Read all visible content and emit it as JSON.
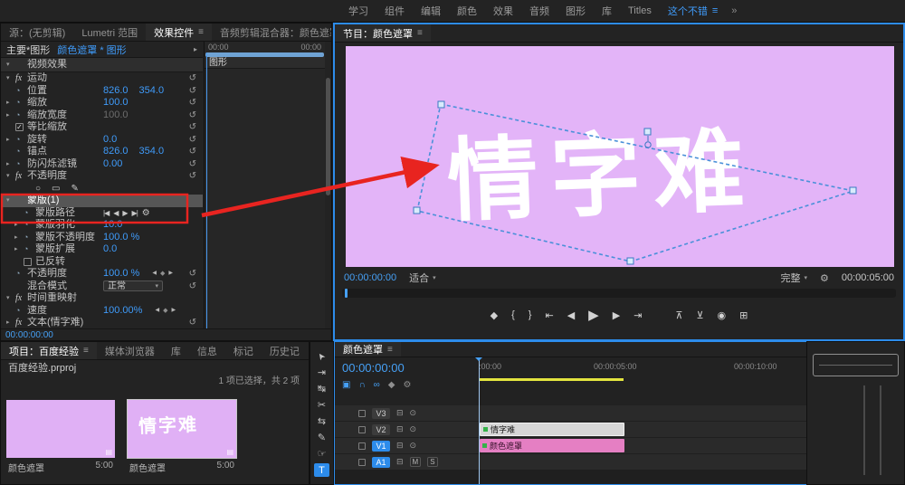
{
  "colors": {
    "accent_blue": "#2d8ceb",
    "value_blue": "#3f9bfa",
    "timecode_blue": "#46a0f5",
    "matte_purple": "#e3b4f8",
    "matte_pink_clip": "#e57fc3",
    "selected_clip_gray": "#d6d6d6",
    "render_bar_yellow": "#e2e43f",
    "annotation_red": "#e82420",
    "mask_outline_blue": "#4a90d9",
    "fx_badge_green": "#36b24a"
  },
  "icons": {
    "menu": "≡",
    "overflow": "»",
    "dropdown": "▾",
    "chevron_open": "▾",
    "chevron_closed": "▸",
    "stopwatch": "◔",
    "reset": "↺",
    "check": "✓",
    "ellipse": "○",
    "rectangle": "▭",
    "pen": "✎",
    "kf_prev": "◀",
    "kf_add": "◆",
    "kf_next": "▶",
    "mask_prev_frame": "|◀",
    "mask_track_back": "◀",
    "mask_track_fwd": "▶",
    "mask_next_frame": "▶|",
    "wrench": "⚙",
    "eye": "⊙",
    "insert": "⊟",
    "marker": "◆",
    "mark_in": "{",
    "mark_out": "}",
    "goto_in": "⇤",
    "step_back": "◀",
    "play": "▶",
    "step_fwd": "▶",
    "goto_out": "⇥",
    "lift": "⊼",
    "extract": "⊻",
    "export_frame": "◉",
    "compare": "⊞",
    "nest": "▣",
    "snap": "∩",
    "link": "∞",
    "settings": "⚙",
    "badge": "▤",
    "tool_selection": "➤",
    "tool_track": "⇥",
    "tool_ripple": "↹",
    "tool_razor": "✂",
    "tool_slip": "⇆",
    "tool_pen": "✎",
    "tool_hand": "☞",
    "tool_type": "T"
  },
  "top_bar": {
    "workspaces": [
      "学习",
      "组件",
      "编辑",
      "颜色",
      "效果",
      "音频",
      "图形",
      "库",
      "Titles",
      "这个不错"
    ],
    "active_workspace": "这个不错"
  },
  "effect_controls": {
    "tabs": [
      {
        "label": "源：(无剪辑)",
        "active": false
      },
      {
        "label": "Lumetri 范围",
        "active": false
      },
      {
        "label": "效果控件",
        "active": true,
        "menu": true
      },
      {
        "label": "音频剪辑混合器：颜色遮罩",
        "active": false
      }
    ],
    "master_label": "主要*图形",
    "clip_label": "颜色遮罩 * 图形",
    "rows": [
      {
        "section": true,
        "chevron": "open",
        "label": "视频效果"
      },
      {
        "chevron": "open",
        "fx": true,
        "label": "运动",
        "reset": true
      },
      {
        "stopwatch": true,
        "label": "位置",
        "values": [
          "826.0",
          "354.0"
        ],
        "reset": true
      },
      {
        "chevron": "closed",
        "stopwatch": true,
        "label": "缩放",
        "values": [
          "100.0"
        ],
        "reset": true
      },
      {
        "chevron": "closed",
        "stopwatch": true,
        "label": "缩放宽度",
        "values": [
          "100.0"
        ],
        "grayed": true,
        "reset": true
      },
      {
        "checkbox": true,
        "label": "等比缩放",
        "reset": true
      },
      {
        "chevron": "closed",
        "stopwatch": true,
        "label": "旋转",
        "values": [
          "0.0"
        ],
        "reset": true
      },
      {
        "stopwatch": true,
        "label": "锚点",
        "values": [
          "826.0",
          "354.0"
        ],
        "reset": true
      },
      {
        "chevron": "closed",
        "stopwatch": true,
        "label": "防闪烁滤镜",
        "values": [
          "0.00"
        ],
        "reset": true
      },
      {
        "chevron": "open",
        "fx": true,
        "label": "不透明度",
        "reset": true
      },
      {
        "tools": true
      },
      {
        "chevron": "open",
        "label": "蒙版(1)",
        "highlighted": true
      },
      {
        "stopwatch": true,
        "label": "蒙版路径",
        "masknav": true,
        "indent": 1
      },
      {
        "chevron": "closed",
        "stopwatch": true,
        "label": "蒙版羽化",
        "values": [
          "10.0"
        ],
        "indent": 1
      },
      {
        "chevron": "closed",
        "stopwatch": true,
        "label": "蒙版不透明度",
        "values": [
          "100.0"
        ],
        "unit": "%",
        "indent": 1
      },
      {
        "chevron": "closed",
        "stopwatch": true,
        "label": "蒙版扩展",
        "values": [
          "0.0"
        ],
        "indent": 1
      },
      {
        "checkbox": false,
        "label": "已反转",
        "indent": 1
      },
      {
        "stopwatch": true,
        "label": "不透明度",
        "values": [
          "100.0"
        ],
        "unit": "%",
        "kfnav": true,
        "reset": true
      },
      {
        "label": "混合模式",
        "dropdown": "正常",
        "reset": true
      },
      {
        "chevron": "open",
        "fx": true,
        "label": "时间重映射"
      },
      {
        "stopwatch": true,
        "label": "速度",
        "values": [
          "100.00%"
        ],
        "kfnav": true
      },
      {
        "chevron": "closed",
        "fx": true,
        "label": "文本(情字难)",
        "reset": true
      }
    ],
    "mini_timeline": {
      "ruler_start": "00:00",
      "ruler_end": "00:00",
      "clip_name": "图形"
    },
    "footer_timecode": "00:00:00:00"
  },
  "program_monitor": {
    "tab": "节目：颜色遮罩",
    "overlay_text": "情字难",
    "timecode": "00:00:00:00",
    "zoom_select": "适合",
    "playback_res": "完整",
    "duration": "00:00:05:00",
    "transport": [
      {
        "name": "add-marker-button",
        "icon": "marker"
      },
      {
        "name": "mark-in-button",
        "icon": "mark_in"
      },
      {
        "name": "mark-out-button",
        "icon": "mark_out"
      },
      {
        "name": "go-to-in-button",
        "icon": "goto_in"
      },
      {
        "name": "step-back-button",
        "icon": "step_back"
      },
      {
        "name": "play-button",
        "icon": "play",
        "big": true
      },
      {
        "name": "step-forward-button",
        "icon": "step_fwd"
      },
      {
        "name": "go-to-out-button",
        "icon": "goto_out"
      },
      {
        "name": "lift-button",
        "icon": "lift",
        "group2": true
      },
      {
        "name": "extract-button",
        "icon": "extract"
      },
      {
        "name": "export-frame-button",
        "icon": "export_frame"
      },
      {
        "name": "comparison-view-button",
        "icon": "compare"
      }
    ]
  },
  "project_panel": {
    "tabs": [
      {
        "label": "项目：百度经验",
        "active": true,
        "menu": true
      },
      {
        "label": "媒体浏览器"
      },
      {
        "label": "库"
      },
      {
        "label": "信息"
      },
      {
        "label": "标记"
      },
      {
        "label": "历史记"
      }
    ],
    "project_file": "百度经验.prproj",
    "selection_info": "1 项已选择，共 2 项",
    "items": [
      {
        "name": "颜色遮罩",
        "duration": "5:00"
      },
      {
        "name": "颜色遮罩",
        "duration": "5:00",
        "thumb_text": "情字难",
        "selected": true
      }
    ]
  },
  "tools": [
    {
      "name": "selection-tool",
      "icon": "tool_selection",
      "rot": true
    },
    {
      "name": "track-select-forward-tool",
      "icon": "tool_track"
    },
    {
      "name": "ripple-edit-tool",
      "icon": "tool_ripple"
    },
    {
      "name": "razor-tool",
      "icon": "tool_razor"
    },
    {
      "name": "slip-tool",
      "icon": "tool_slip"
    },
    {
      "name": "pen-tool",
      "icon": "tool_pen"
    },
    {
      "name": "hand-tool",
      "icon": "tool_hand"
    },
    {
      "name": "type-tool",
      "icon": "tool_type",
      "active": true
    }
  ],
  "timeline": {
    "tab": "颜色遮罩",
    "timecode": "00:00:00:00",
    "ruler_labels": [
      ":00:00",
      "00:00:05:00",
      "00:00:10:00"
    ],
    "toolbar": [
      {
        "name": "nest-toggle",
        "icon": "nest",
        "on": true
      },
      {
        "name": "snap-toggle",
        "icon": "snap",
        "on": true
      },
      {
        "name": "linked-selection-toggle",
        "icon": "link",
        "on": true
      },
      {
        "name": "add-marker-button",
        "icon": "marker",
        "on": false
      },
      {
        "name": "timeline-settings-button",
        "icon": "settings",
        "on": false
      }
    ],
    "tracks": [
      {
        "name": "V3",
        "targeted": false,
        "audio": false
      },
      {
        "name": "V2",
        "targeted": false,
        "audio": false
      },
      {
        "name": "V1",
        "targeted": true,
        "audio": false
      },
      {
        "name": "A1",
        "targeted": true,
        "audio": true
      }
    ],
    "audio_buttons": [
      "M",
      "S"
    ],
    "clips": [
      {
        "name": "情字难",
        "track": "V2",
        "kind": "graphic"
      },
      {
        "name": "颜色遮罩",
        "track": "V1",
        "kind": "matte"
      }
    ]
  },
  "annotations": {
    "highlighted_row": "蒙版(1)"
  }
}
